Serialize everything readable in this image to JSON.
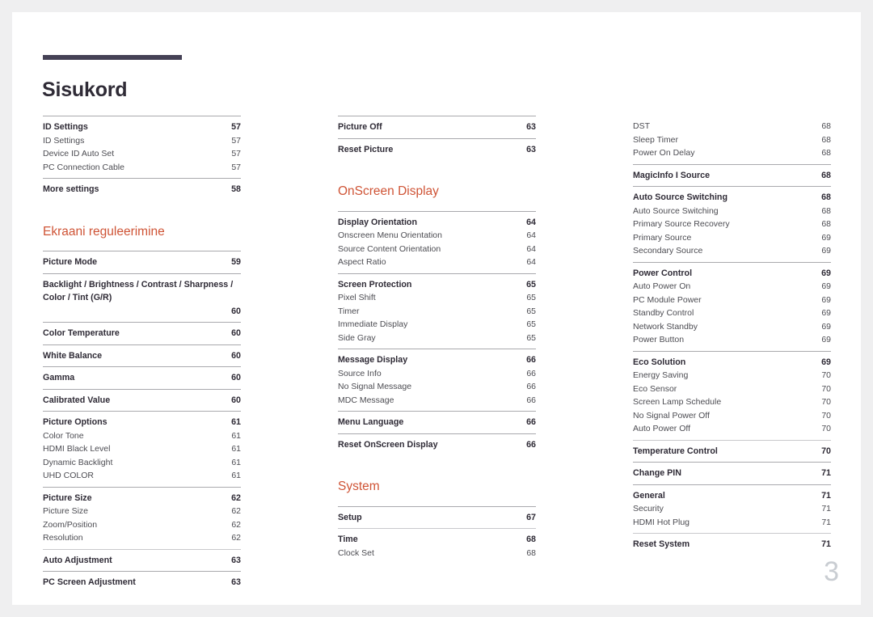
{
  "document": {
    "title": "Sisukord",
    "folio": "3",
    "accent_color": "#cf5436",
    "title_bar_color": "#454155"
  },
  "columns": [
    {
      "name": "column-1",
      "blocks": [
        {
          "type": "group",
          "rule": "strong",
          "entries": [
            {
              "style": "head",
              "label": "ID Settings",
              "page": "57"
            },
            {
              "style": "sub",
              "label": "ID Settings",
              "page": "57"
            },
            {
              "style": "sub",
              "label": "Device ID Auto Set",
              "page": "57"
            },
            {
              "style": "sub",
              "label": "PC Connection Cable",
              "page": "57"
            }
          ]
        },
        {
          "type": "group",
          "rule": "strong",
          "entries": [
            {
              "style": "head",
              "label": "More settings",
              "page": "58"
            }
          ]
        },
        {
          "type": "heading",
          "label": "Ekraani reguleerimine"
        },
        {
          "type": "group",
          "rule": "strong",
          "entries": [
            {
              "style": "head",
              "label": "Picture Mode",
              "page": "59"
            }
          ]
        },
        {
          "type": "group",
          "rule": "strong",
          "entries": [
            {
              "style": "head",
              "wrap": true,
              "label": "Backlight / Brightness / Contrast / Sharpness / Color / Tint (G/R)",
              "page": "60"
            }
          ]
        },
        {
          "type": "group",
          "rule": "strong",
          "entries": [
            {
              "style": "head",
              "label": "Color Temperature",
              "page": "60"
            }
          ]
        },
        {
          "type": "group",
          "rule": "strong",
          "entries": [
            {
              "style": "head",
              "label": "White Balance",
              "page": "60"
            }
          ]
        },
        {
          "type": "group",
          "rule": "strong",
          "entries": [
            {
              "style": "head",
              "label": "Gamma",
              "page": "60"
            }
          ]
        },
        {
          "type": "group",
          "rule": "strong",
          "entries": [
            {
              "style": "head",
              "label": "Calibrated Value",
              "page": "60"
            }
          ]
        },
        {
          "type": "group",
          "rule": "strong",
          "entries": [
            {
              "style": "head",
              "label": "Picture Options",
              "page": "61"
            },
            {
              "style": "sub",
              "label": "Color Tone",
              "page": "61"
            },
            {
              "style": "sub",
              "label": "HDMI Black Level",
              "page": "61"
            },
            {
              "style": "sub",
              "label": "Dynamic Backlight",
              "page": "61"
            },
            {
              "style": "sub",
              "label": "UHD COLOR",
              "page": "61"
            }
          ]
        },
        {
          "type": "group",
          "rule": "strong",
          "entries": [
            {
              "style": "head",
              "label": "Picture Size",
              "page": "62"
            },
            {
              "style": "sub",
              "label": "Picture Size",
              "page": "62"
            },
            {
              "style": "sub",
              "label": "Zoom/Position",
              "page": "62"
            },
            {
              "style": "sub",
              "label": "Resolution",
              "page": "62"
            }
          ]
        },
        {
          "type": "group",
          "rule": "soft",
          "entries": [
            {
              "style": "head",
              "label": "Auto Adjustment",
              "page": "63"
            }
          ]
        },
        {
          "type": "group",
          "rule": "strong",
          "entries": [
            {
              "style": "head",
              "label": "PC Screen Adjustment",
              "page": "63"
            }
          ]
        }
      ]
    },
    {
      "name": "column-2",
      "blocks": [
        {
          "type": "group",
          "rule": "strong",
          "entries": [
            {
              "style": "head",
              "label": "Picture Off",
              "page": "63"
            }
          ]
        },
        {
          "type": "group",
          "rule": "strong",
          "entries": [
            {
              "style": "head",
              "label": "Reset Picture",
              "page": "63"
            }
          ]
        },
        {
          "type": "heading",
          "label": "OnScreen Display"
        },
        {
          "type": "group",
          "rule": "strong",
          "entries": [
            {
              "style": "head",
              "label": "Display Orientation",
              "page": "64"
            },
            {
              "style": "sub",
              "label": "Onscreen Menu Orientation",
              "page": "64"
            },
            {
              "style": "sub",
              "label": "Source Content Orientation",
              "page": "64"
            },
            {
              "style": "sub",
              "label": "Aspect Ratio",
              "page": "64"
            }
          ]
        },
        {
          "type": "group",
          "rule": "strong",
          "entries": [
            {
              "style": "head",
              "label": "Screen Protection",
              "page": "65"
            },
            {
              "style": "sub",
              "label": "Pixel Shift",
              "page": "65"
            },
            {
              "style": "sub",
              "label": "Timer",
              "page": "65"
            },
            {
              "style": "sub",
              "label": "Immediate Display",
              "page": "65"
            },
            {
              "style": "sub",
              "label": "Side Gray",
              "page": "65"
            }
          ]
        },
        {
          "type": "group",
          "rule": "strong",
          "entries": [
            {
              "style": "head",
              "label": "Message Display",
              "page": "66"
            },
            {
              "style": "sub",
              "label": "Source Info",
              "page": "66"
            },
            {
              "style": "sub",
              "label": "No Signal Message",
              "page": "66"
            },
            {
              "style": "sub",
              "label": "MDC Message",
              "page": "66"
            }
          ]
        },
        {
          "type": "group",
          "rule": "strong",
          "entries": [
            {
              "style": "head",
              "label": "Menu Language",
              "page": "66"
            }
          ]
        },
        {
          "type": "group",
          "rule": "strong",
          "entries": [
            {
              "style": "head",
              "label": "Reset OnScreen Display",
              "page": "66"
            }
          ]
        },
        {
          "type": "heading",
          "label": "System"
        },
        {
          "type": "group",
          "rule": "strong",
          "entries": [
            {
              "style": "head",
              "label": "Setup",
              "page": "67"
            }
          ]
        },
        {
          "type": "group",
          "rule": "soft",
          "entries": [
            {
              "style": "head",
              "label": "Time",
              "page": "68"
            },
            {
              "style": "sub",
              "label": "Clock Set",
              "page": "68"
            }
          ]
        }
      ]
    },
    {
      "name": "column-3",
      "blocks": [
        {
          "type": "group",
          "rule": "none",
          "entries": [
            {
              "style": "sub",
              "label": "DST",
              "page": "68"
            },
            {
              "style": "sub",
              "label": "Sleep Timer",
              "page": "68"
            },
            {
              "style": "sub",
              "label": "Power On Delay",
              "page": "68"
            }
          ]
        },
        {
          "type": "group",
          "rule": "strong",
          "entries": [
            {
              "style": "head",
              "label": "MagicInfo I Source",
              "page": "68"
            }
          ]
        },
        {
          "type": "group",
          "rule": "strong",
          "entries": [
            {
              "style": "head",
              "label": "Auto Source Switching",
              "page": "68"
            },
            {
              "style": "sub",
              "label": "Auto Source Switching",
              "page": "68"
            },
            {
              "style": "sub",
              "label": "Primary Source Recovery",
              "page": "68"
            },
            {
              "style": "sub",
              "label": "Primary Source",
              "page": "69"
            },
            {
              "style": "sub",
              "label": "Secondary Source",
              "page": "69"
            }
          ]
        },
        {
          "type": "group",
          "rule": "strong",
          "entries": [
            {
              "style": "head",
              "label": "Power Control",
              "page": "69"
            },
            {
              "style": "sub",
              "label": "Auto Power On",
              "page": "69"
            },
            {
              "style": "sub",
              "label": "PC Module Power",
              "page": "69"
            },
            {
              "style": "sub",
              "label": "Standby Control",
              "page": "69"
            },
            {
              "style": "sub",
              "label": "Network Standby",
              "page": "69"
            },
            {
              "style": "sub",
              "label": "Power Button",
              "page": "69"
            }
          ]
        },
        {
          "type": "group",
          "rule": "strong",
          "entries": [
            {
              "style": "head",
              "label": "Eco Solution",
              "page": "69"
            },
            {
              "style": "sub",
              "label": "Energy Saving",
              "page": "70"
            },
            {
              "style": "sub",
              "label": "Eco Sensor",
              "page": "70"
            },
            {
              "style": "sub",
              "label": "Screen Lamp Schedule",
              "page": "70"
            },
            {
              "style": "sub",
              "label": "No Signal Power Off",
              "page": "70"
            },
            {
              "style": "sub",
              "label": "Auto Power Off",
              "page": "70"
            }
          ]
        },
        {
          "type": "group",
          "rule": "soft",
          "entries": [
            {
              "style": "head",
              "label": "Temperature Control",
              "page": "70"
            }
          ]
        },
        {
          "type": "group",
          "rule": "strong",
          "entries": [
            {
              "style": "head",
              "label": "Change PIN",
              "page": "71"
            }
          ]
        },
        {
          "type": "group",
          "rule": "strong",
          "entries": [
            {
              "style": "head",
              "label": "General",
              "page": "71"
            },
            {
              "style": "sub",
              "label": "Security",
              "page": "71"
            },
            {
              "style": "sub",
              "label": "HDMI Hot Plug",
              "page": "71"
            }
          ]
        },
        {
          "type": "group",
          "rule": "soft",
          "entries": [
            {
              "style": "head",
              "label": "Reset System",
              "page": "71"
            }
          ]
        }
      ]
    }
  ]
}
